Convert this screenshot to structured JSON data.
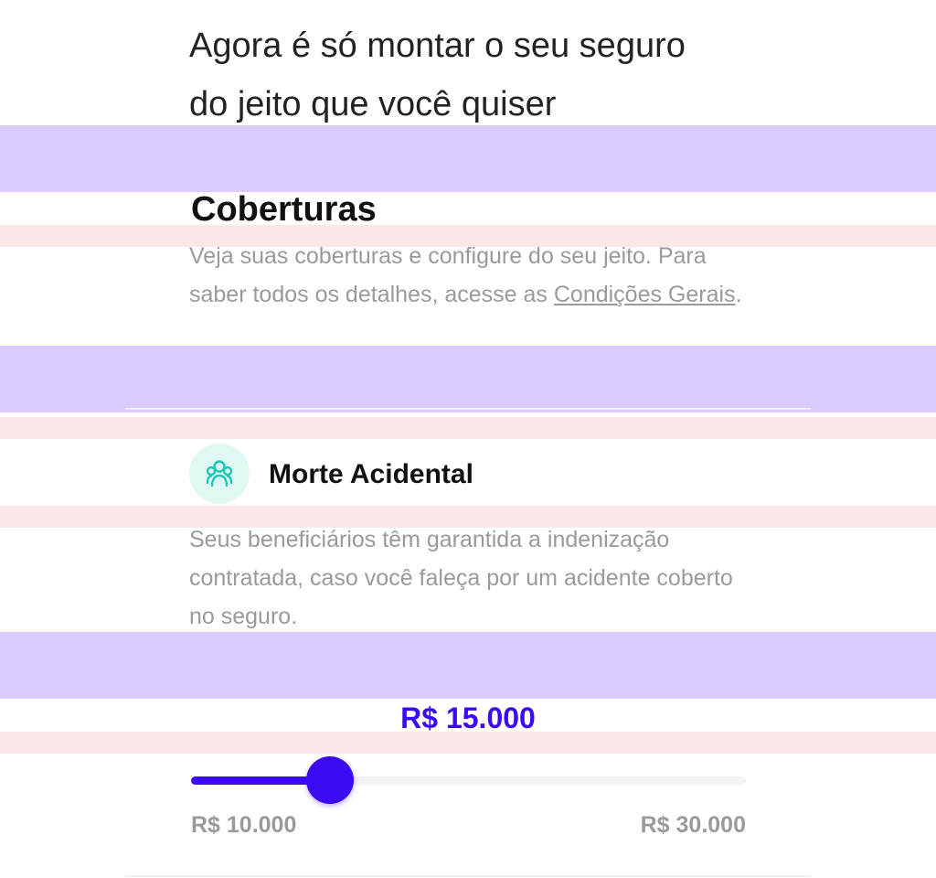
{
  "intro": {
    "line1": "Agora é só montar o seu seguro",
    "line2": "do jeito que você quiser"
  },
  "coverages": {
    "title": "Coberturas",
    "description_prefix": "Veja suas coberturas e configure do seu jeito. Para saber todos os detalhes, acesse as ",
    "link_label": "Condições Gerais",
    "description_suffix": "."
  },
  "coverage_item": {
    "icon": "people-icon",
    "title": "Morte Acidental",
    "description": "Seus beneficiários têm garantida a indenização contratada, caso você faleça por um acidente coberto no seguro."
  },
  "slider": {
    "value_label": "R$ 15.000",
    "value": 15000,
    "min": 10000,
    "max": 30000,
    "min_label": "R$ 10.000",
    "max_label": "R$ 30.000"
  },
  "colors": {
    "accent": "#3b0af2",
    "band_purple": "#dacdfd",
    "band_pink": "#fde6e8",
    "icon_teal": "#19c9b6",
    "icon_bg": "#e0f8f4"
  }
}
